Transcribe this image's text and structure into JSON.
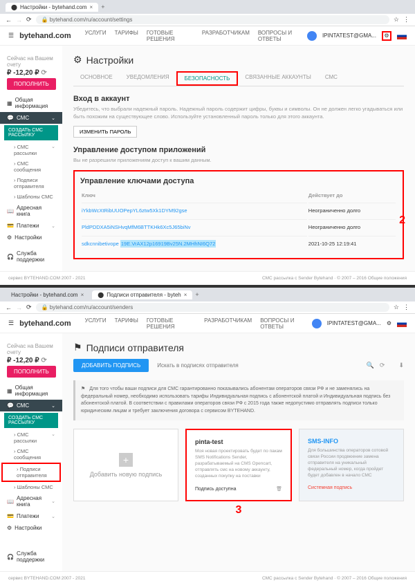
{
  "screenshot1": {
    "tab_title": "Настройки - bytehand.com",
    "url": "bytehand.com/ru/account/settings",
    "brand": "bytehand.com",
    "nav": [
      "УСЛУГИ",
      "ТАРИФЫ",
      "ГОТОВЫЕ РЕШЕНИЯ",
      "РАЗРАБОТЧИКАМ",
      "ВОПРОСЫ И ОТВЕТЫ"
    ],
    "user_email": "IPINTATEST@GMA...",
    "balance_label": "Сейчас на Вашем счету",
    "balance_value": "-12,20 ₽",
    "btn_topup": "ПОПОЛНИТЬ",
    "sidebar": {
      "general": "Общая информация",
      "sms": "СМС",
      "create": "СОЗДАТЬ СМС РАССЫЛКУ",
      "subs": [
        "СМС рассылки",
        "СМС сообщения",
        "Подписи отправителя",
        "Шаблоны СМС"
      ],
      "addr": "Адресная книга",
      "pay": "Платежи",
      "settings": "Настройки",
      "support": "Служба поддержки"
    },
    "page_title": "Настройки",
    "tabs": [
      "ОСНОВНОЕ",
      "УВЕДОМЛЕНИЯ",
      "БЕЗОПАСНОСТЬ",
      "СВЯЗАННЫЕ АККАУНТЫ",
      "СМС"
    ],
    "login_h": "Вход в аккаунт",
    "login_p": "Убедитесь, что выбрали надежный пароль. Надежный пароль содержит цифры, буквы и символы. Он не должен легко угадываться или быть похожим на существующее слово. Используйте установленный пароль только для этого аккаунта.",
    "btn_change_pw": "ИЗМЕНИТЬ ПАРОЛЬ",
    "apps_h": "Управление доступом приложений",
    "apps_p": "Вы не разрешили приложениям доступ к вашим данным.",
    "keys_h": "Управление ключами доступа",
    "keys_th1": "Ключ",
    "keys_th2": "Действует до",
    "keys": [
      {
        "k": "iYkbWcXtRibUUOPepYL6ztw5Xk1DYM92gse",
        "exp": "Неограниченно долго"
      },
      {
        "k": "PldPDDXA5iNSHvqMfM6BTTKHk6Xc5J65biNv",
        "exp": "Неограниченно долго"
      },
      {
        "k": "19E.VrAX12p16919Bv25N.2MHhNI6Q72",
        "exp": "2021-10-25 12:19:41"
      }
    ],
    "key_prefix": "sdkcnnibetivope"
  },
  "screenshot2": {
    "tab_title": "Подписи отправителя - byteh",
    "url": "bytehand.com/ru/account/senders",
    "page_title": "Подписи отправителя",
    "btn_add": "ДОБАВИТЬ ПОДПИСЬ",
    "search_ph": "Искать в подписях отправителя",
    "info_text": "Для того чтобы ваши подписи для СМС гарантированно показывались абонентам операторов связи РФ и не заменялись на федеральный номер, необходимо использовать тарифы Индивидуальная подпись с абонентской платой и Индивидуальная подпись без абонентской платой. В соответствии с правилами операторов связи РФ с 2015 года также недопустимо отправлять подписи только юридическим лицам и требует заключения договора с сервисом BYTEHAND.",
    "card_add": "Добавить новую подпись",
    "card_pinta": {
      "title": "pinta-test",
      "text": "Моя новая проектировать будет по пакам SMS Notifications Sender, разрабатываемый на CMS Opencart, отправлять смс на новому аккаунту, созданных покупку на поставки",
      "footer": "Подпись доступна"
    },
    "card_sms": {
      "title": "SMS-INFO",
      "text": "Для большинства операторов сотовой связи России продвюение замена отправителя на уникальный федеральный номер, когда пройдет будет добавлен в начало СМС",
      "footer": "Системная подпись"
    },
    "sidebar_subs": [
      "СМС рассылки",
      "СМС сообщения",
      "Подписи отправителя",
      "Шаблоны СМС"
    ]
  },
  "footer_left": "сервис BYTEHAND.COM 2007 - 2021",
  "footer_right": "СМС рассылка с Sender Bytehand · © 2007 – 2016 Общие положения"
}
